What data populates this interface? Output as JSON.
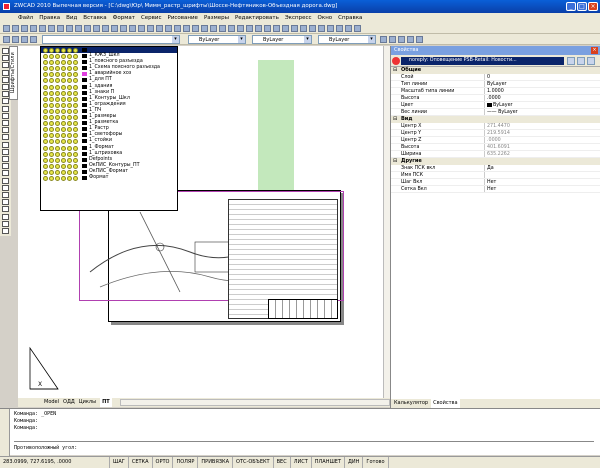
{
  "window": {
    "title": "ZWCAD 2010 Выпечная версия - [C:\\dwg\\Юр\\ Мимм_растр_шрифты\\Шоссе-Нефтяников-Объездная дорога.dwg]"
  },
  "menu": [
    "Файл",
    "Правка",
    "Вид",
    "Вставка",
    "Формат",
    "Сервис",
    "Рисование",
    "Размеры",
    "Редактировать",
    "Экспресс",
    "Окно",
    "Справка"
  ],
  "toolbar": {
    "linetype1": "ByLayer",
    "linetype2": "ByLayer",
    "lineweight": "ByLayer"
  },
  "left_tab": "Шрифты/Стили",
  "layers": [
    "1_КЖЗ_Шкл",
    "1_поясного разъезда",
    "1_Схема поясного разъезда",
    "1_аварийное хоз",
    "1_для ПТ",
    "1_здания",
    "1_знаки П",
    "1_Контуры_Шкл",
    "1_ограждения",
    "1_ПЧ",
    "1_размеры",
    "1_разметка",
    "1_Растр",
    "1_светофоры",
    "1_стойки",
    "1_Формат",
    "1_штриховка",
    "Defpoints",
    "ОкПИС_Контуры_ПТ",
    "ОкПИС_Формат",
    "Формат"
  ],
  "model_tabs": [
    "Model",
    "ОДД",
    "Циклы",
    "ПТ"
  ],
  "active_tab": "ПТ",
  "properties": {
    "title": "Свойства",
    "selection": "noreply: Оповещение PSB-Retail: Новости...",
    "sections": [
      {
        "name": "Общие",
        "rows": [
          {
            "k": "Слой",
            "v": "0"
          },
          {
            "k": "Тип линии",
            "v": "ByLayer"
          },
          {
            "k": "Масштаб типа линии",
            "v": "1.0000"
          },
          {
            "k": "Высота",
            "v": ".0000"
          },
          {
            "k": "Цвет",
            "v": "ByLayer"
          },
          {
            "k": "Вес линии",
            "v": "—— ByLayer"
          }
        ]
      },
      {
        "name": "Вид",
        "rows": [
          {
            "k": "Центр X",
            "v": "271.4470",
            "dim": true
          },
          {
            "k": "Центр Y",
            "v": "219.5914",
            "dim": true
          },
          {
            "k": "Центр Z",
            "v": ".0000",
            "dim": true
          },
          {
            "k": "Высота",
            "v": "401.6091",
            "dim": true
          },
          {
            "k": "Ширина",
            "v": "635.2262",
            "dim": true
          }
        ]
      },
      {
        "name": "Другие",
        "rows": [
          {
            "k": "Знак ПСК вкл",
            "v": "Да"
          },
          {
            "k": "Имя ПСК",
            "v": ""
          },
          {
            "k": "Шаг Вкл",
            "v": "Нет"
          },
          {
            "k": "Сетка Вкл",
            "v": "Нет"
          }
        ]
      }
    ],
    "tabs": [
      "Калькулятор",
      "Свойства"
    ]
  },
  "command": {
    "lines": [
      "Команда: _OPEN",
      "Команда:",
      "Команда:"
    ],
    "prompt": "Противоположный угол:"
  },
  "status": {
    "coords": "283.0999, 727.6195, .0000",
    "modes": [
      "ШАГ",
      "СЕТКА",
      "ОРТО",
      "ПОЛЯР",
      "ПРИВЯЗКА",
      "ОТС-ОБЪЕКТ",
      "ВЕС",
      "ЛИСТ",
      "ПЛАНШЕТ",
      "ДИН"
    ],
    "ready": "Готово"
  }
}
